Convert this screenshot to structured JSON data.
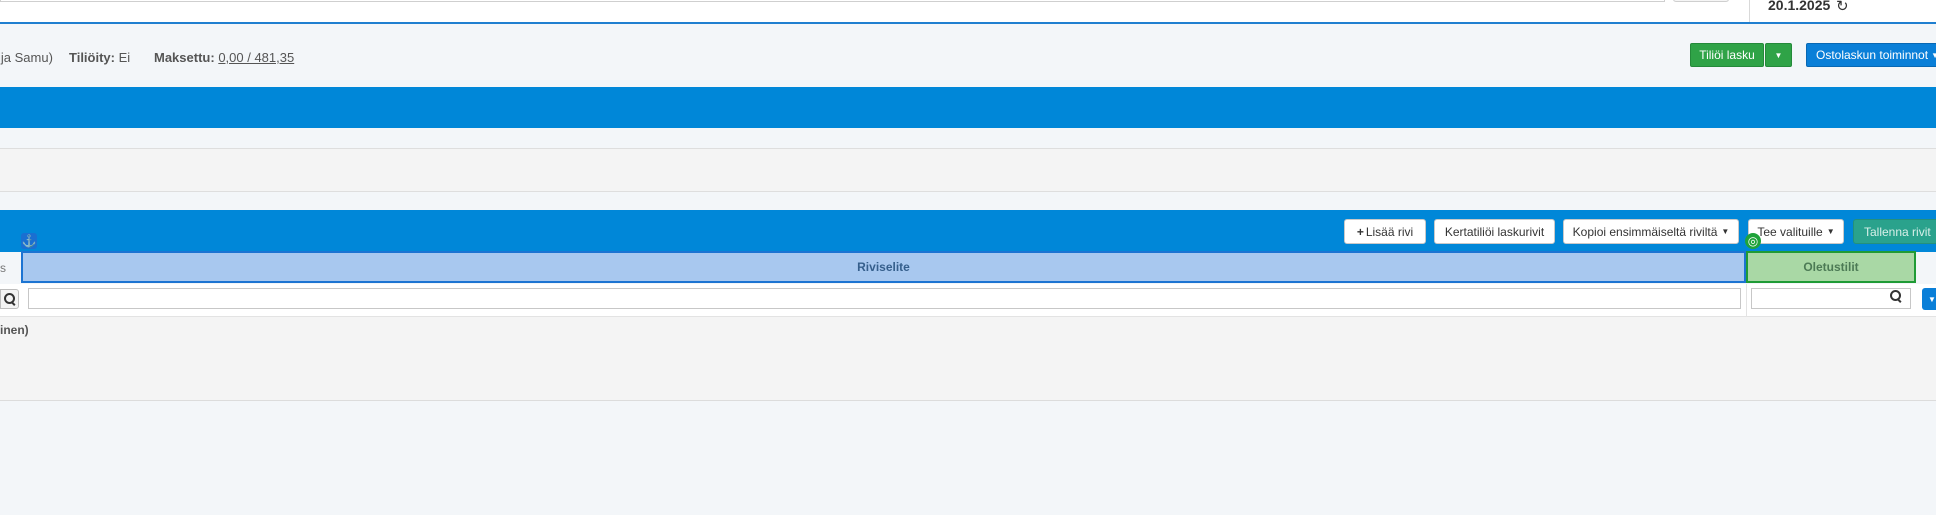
{
  "header": {
    "date": "20.1.2025",
    "refresh_icon": "refresh-icon"
  },
  "info": {
    "approver_fragment": "ija Samu)",
    "tilioity_label": "Tiliöity:",
    "tilioity_value": "Ei",
    "maksettu_label": "Maksettu:",
    "maksettu_value": "0,00 / 481,35"
  },
  "actions": {
    "tilioi_lasku": "Tiliöi lasku",
    "ostolaskun_toiminnot": "Ostolaskun toiminnot"
  },
  "toolbar": {
    "lisaa_rivi": "Lisää rivi",
    "kertatilioi": "Kertatiliöi laskurivit",
    "kopioi": "Kopioi ensimmäiseltä riviltä",
    "tee_valituille": "Tee valituille",
    "tallenna": "Tallenna rivit"
  },
  "table": {
    "left_edge_text": "s",
    "columns": [
      {
        "label": "Riviselite"
      },
      {
        "label": "Oletustilit"
      }
    ],
    "body_left_text": "inen)"
  },
  "colors": {
    "primary_blue": "#0087d8",
    "success_green": "#2fa347",
    "teal": "#2aa28c"
  }
}
